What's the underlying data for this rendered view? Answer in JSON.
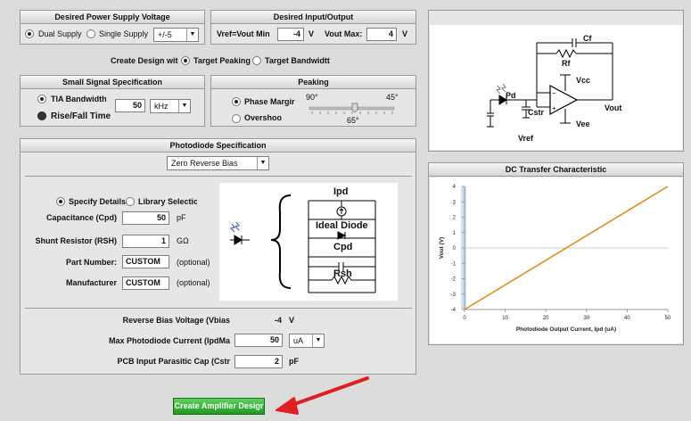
{
  "supply": {
    "title": "Desired Power Supply Voltage",
    "dual_label": "Dual Supply",
    "single_label": "Single Supply",
    "supply_value": "+/-5"
  },
  "io": {
    "title": "Desired Input/Output",
    "vmin_label": "Vref=Vout Min",
    "vmin_value": "-4",
    "vmin_unit": "V",
    "vmax_label": "Vout Max:",
    "vmax_value": "4",
    "vmax_unit": "V"
  },
  "design": {
    "label": "Create Design wit",
    "peaking_label": "Target Peaking",
    "bandwidth_label": "Target Bandwidtt"
  },
  "small_signal": {
    "title": "Small Signal Specification",
    "tia_label": "TIA Bandwidth",
    "rise_label": "Rise/Fall Time",
    "value": "50",
    "unit": "kHz"
  },
  "peaking": {
    "title": "Peaking",
    "phase_label": "Phase Margir",
    "overshoot_label": "Overshoo",
    "slider_min": "90°",
    "slider_max": "45°",
    "slider_value": "65°"
  },
  "photodiode": {
    "title": "Photodiode Specification",
    "bias_mode": "Zero Reverse Bias",
    "specify_label": "Specify Details",
    "library_label": "Library Selection",
    "cap_label": "Capacitance (Cpd)",
    "cap_value": "50",
    "cap_unit": "pF",
    "shunt_label": "Shunt Resistor (RSH)",
    "shunt_value": "1",
    "shunt_unit": "GΩ",
    "part_label": "Part Number:",
    "part_value": "CUSTOM",
    "part_opt": "(optional)",
    "mfr_label": "Manufacturer",
    "mfr_value": "CUSTOM",
    "mfr_opt": "(optional)",
    "model": {
      "ipd": "Ipd",
      "ideal": "Ideal Diode",
      "cpd": "Cpd",
      "rsh": "Rsh"
    },
    "reverse_label": "Reverse Bias Voltage (Vbias",
    "reverse_value": "-4",
    "reverse_unit": "V",
    "maxcur_label": "Max Photodiode Current (IpdMa",
    "maxcur_value": "50",
    "maxcur_unit": "uA",
    "cstr_label": "PCB Input Parasitic Cap (Cstr",
    "cstr_value": "2",
    "cstr_unit": "pF"
  },
  "schematic": {
    "cf": "Cf",
    "rf": "Rf",
    "vcc": "Vcc",
    "pd": "Pd",
    "cstr": "Cstr",
    "vout": "Vout",
    "vee": "Vee",
    "vref": "Vref"
  },
  "create_button": "Create Amplifier Desigr",
  "chart_data": {
    "type": "line",
    "title": "DC Transfer Characteristic",
    "xlabel": "Photodiode Output Current, Ipd (uA)",
    "ylabel": "Vout (V)",
    "xlim": [
      0,
      50
    ],
    "ylim": [
      -4,
      4
    ],
    "x_ticks": [
      "0",
      "10",
      "20",
      "30",
      "40",
      "50"
    ],
    "y_ticks": [
      "4",
      "3",
      "2",
      "1",
      "0",
      "-1",
      "-2",
      "-3",
      "-4"
    ],
    "grid": "horizontal line at 0",
    "series": [
      {
        "x": [
          0,
          50
        ],
        "y": [
          -4,
          4
        ],
        "color": "#e08a1e"
      }
    ]
  },
  "colors": {
    "accent_green": "#2aa52a",
    "arrow_red": "#e02020",
    "line_orange": "#e08a1e"
  }
}
